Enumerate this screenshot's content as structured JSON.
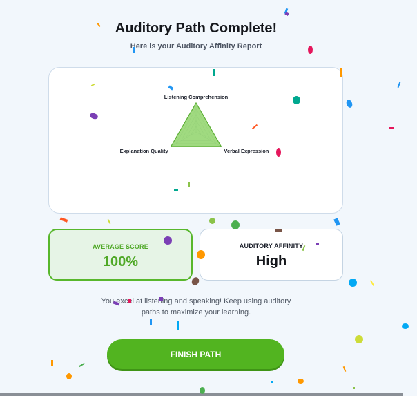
{
  "header": {
    "title": "Auditory Path Complete!",
    "subtitle": "Here is your Auditory Affinity Report"
  },
  "radar": {
    "axes": [
      "Listening Comprehension",
      "Verbal Expression",
      "Explanation Quality"
    ],
    "values": [
      100,
      100,
      100
    ],
    "max": 100,
    "levels": 5,
    "fill_color": "#8fd46a",
    "stroke_color": "#5cae35"
  },
  "stats": {
    "score_label": "AVERAGE SCORE",
    "score_value": "100%",
    "affinity_label": "AUDITORY AFFINITY",
    "affinity_value": "High"
  },
  "message": {
    "line1": "You excel at listening and speaking! Keep using auditory",
    "line2": "paths to maximize your learning."
  },
  "actions": {
    "finish_label": "FINISH PATH"
  },
  "colors": {
    "accent": "#52b420",
    "score_bg": "#e6f4e6",
    "card_border": "#cfdcea",
    "background": "#f2f7fc"
  }
}
